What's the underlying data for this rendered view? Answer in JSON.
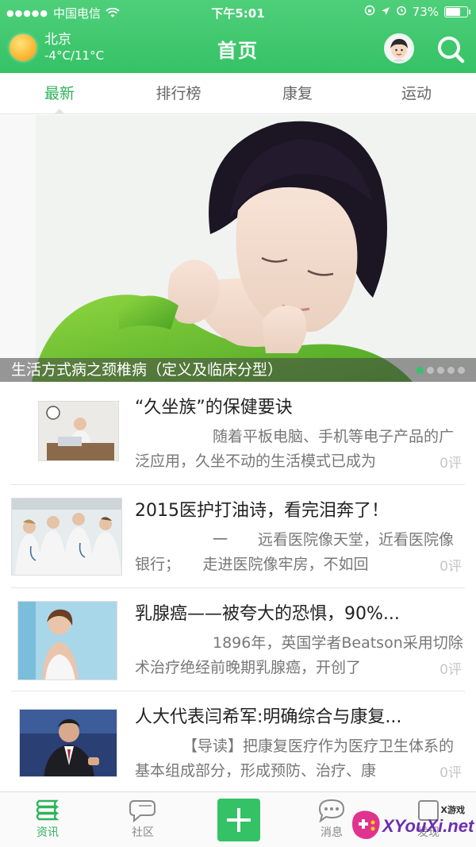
{
  "status_bar": {
    "carrier": "中国电信",
    "time": "下午5:01",
    "battery": "73%",
    "battery_level": 0.73
  },
  "header": {
    "city": "北京",
    "temperature": "-4°C/11°C",
    "title": "首页"
  },
  "tabs": [
    {
      "label": "最新",
      "active": true
    },
    {
      "label": "排行榜",
      "active": false
    },
    {
      "label": "康复",
      "active": false
    },
    {
      "label": "运动",
      "active": false
    }
  ],
  "banner": {
    "caption": "生活方式病之颈椎病（定义及临床分型）",
    "pages": 5,
    "current_page": 1
  },
  "news": [
    {
      "title": "“久坐族”的保健要诀",
      "summary": "随着平板电脑、手机等电子产品的广泛应用，久坐不动的生活模式已成为",
      "count": "0评"
    },
    {
      "title": "2015医护打油诗，看完泪奔了！",
      "summary": "一　　远看医院像天堂，近看医院像银行；　　走进医院像牢房，不如回",
      "count": "0评"
    },
    {
      "title": "乳腺癌——被夸大的恐惧，90%...",
      "summary": "1896年，英国学者Beatson采用切除术治疗绝经前晚期乳腺癌，开创了",
      "count": "0评"
    },
    {
      "title": "人大代表闫希军:明确综合与康复...",
      "summary": "【导读】把康复医疗作为医疗卫生体系的基本组成部分，形成预防、治疗、康",
      "count": "0评"
    }
  ],
  "bottom_nav": [
    {
      "label": "资讯",
      "icon": "books-icon",
      "active": true
    },
    {
      "label": "社区",
      "icon": "chat-bubble-icon",
      "active": false
    },
    {
      "label": "",
      "icon": "plus-icon",
      "active": false
    },
    {
      "label": "消息",
      "icon": "message-icon",
      "active": false
    },
    {
      "label": "发现",
      "icon": "discover-icon",
      "active": false
    }
  ],
  "watermark": {
    "text": "XYouXi.net",
    "small": "X游戏"
  },
  "colors": {
    "brand_green": "#35c266",
    "active_tab": "#2fb35d"
  }
}
